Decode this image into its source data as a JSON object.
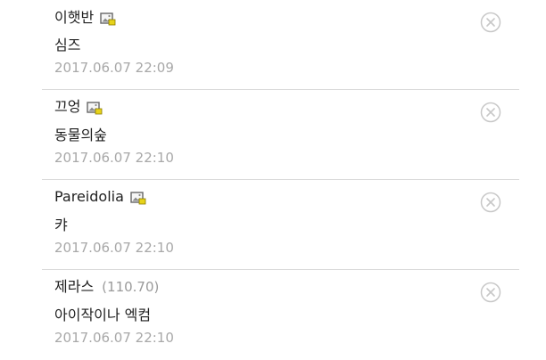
{
  "comments": [
    {
      "author": "이햇반",
      "ip": "",
      "has_image_icon": true,
      "text": "심즈",
      "time": "2017.06.07 22:09",
      "delete_icon": "close-circle-icon"
    },
    {
      "author": "끄엉",
      "ip": "",
      "has_image_icon": true,
      "text": "동물의숲",
      "time": "2017.06.07 22:10",
      "delete_icon": "close-circle-icon"
    },
    {
      "author": "Pareidolia",
      "ip": "",
      "has_image_icon": true,
      "text": "캬",
      "time": "2017.06.07 22:10",
      "delete_icon": "close-circle-icon"
    },
    {
      "author": "제라스",
      "ip": "(110.70)",
      "has_image_icon": false,
      "text": "아이작이나 엑컴",
      "time": "2017.06.07 22:10",
      "delete_icon": "close-circle-icon"
    }
  ],
  "colors": {
    "text": "#1f1f1f",
    "muted": "#a8a8a8",
    "divider": "#d9d9d9",
    "delete_icon": "#c8c8c8",
    "image_icon_badge": "#e7d31a"
  }
}
